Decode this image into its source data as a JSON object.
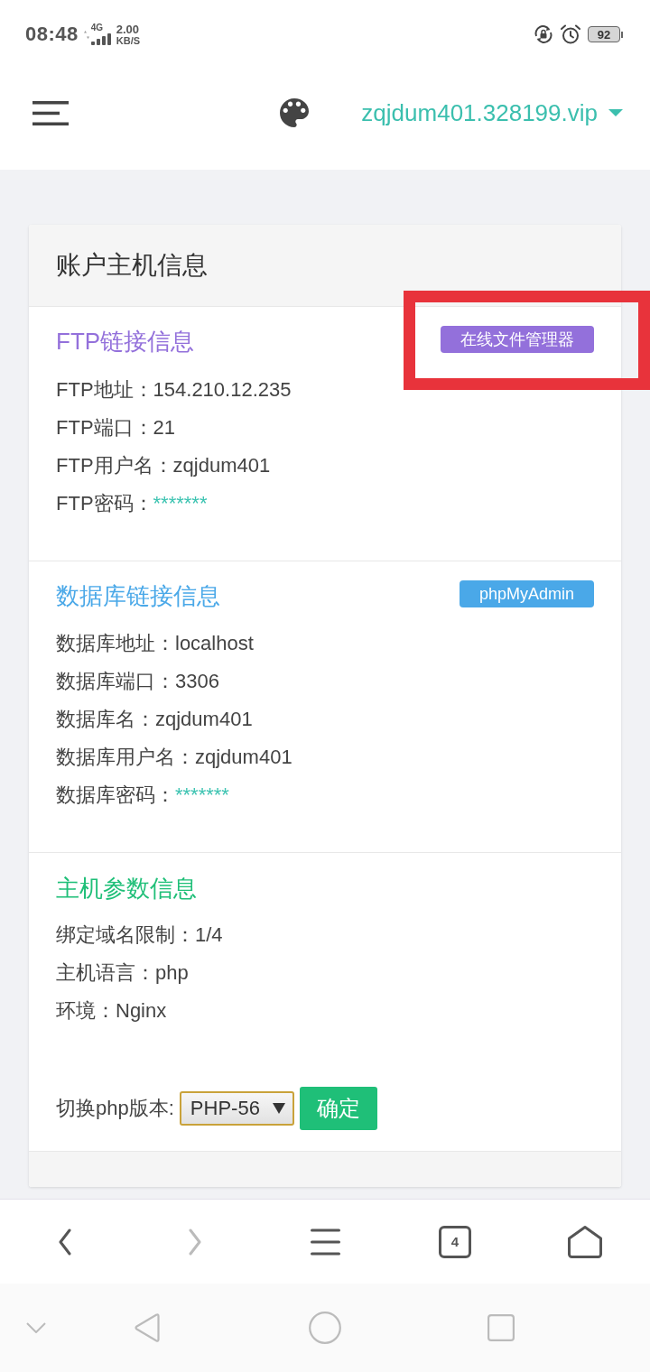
{
  "status_bar": {
    "time": "08:48",
    "network": "4G",
    "speed_value": "2.00",
    "speed_unit": "KB/S",
    "battery": "92"
  },
  "header": {
    "account": "zqjdum401.328199.vip"
  },
  "card": {
    "title": "账户主机信息",
    "sections": [
      {
        "title": "FTP链接信息",
        "color": "#9370db",
        "action": "在线文件管理器",
        "rows": [
          {
            "kind": "plain",
            "label": "FTP地址：",
            "value": "154.210.12.235"
          },
          {
            "kind": "plain",
            "label": "FTP端口：",
            "value": "21"
          },
          {
            "kind": "plain",
            "label": "FTP用户名：",
            "value": "zqjdum401"
          },
          {
            "kind": "secret",
            "label": "FTP密码：",
            "value": "*******"
          }
        ]
      },
      {
        "title": "数据库链接信息",
        "color": "#4aa8e8",
        "action": "phpMyAdmin",
        "rows": [
          {
            "kind": "plain",
            "label": "数据库地址：",
            "value": "localhost"
          },
          {
            "kind": "plain",
            "label": "数据库端口：",
            "value": "3306"
          },
          {
            "kind": "plain",
            "label": "数据库名：",
            "value": "zqjdum401"
          },
          {
            "kind": "plain",
            "label": "数据库用户名：",
            "value": "zqjdum401"
          },
          {
            "kind": "secret",
            "label": "数据库密码：",
            "value": "*******"
          }
        ]
      },
      {
        "title": "主机参数信息",
        "color": "#1fbf78",
        "rows": [
          {
            "kind": "plain",
            "label": "绑定域名限制：",
            "value": "1/4"
          },
          {
            "kind": "plain",
            "label": "主机语言：",
            "value": "php"
          },
          {
            "kind": "plain",
            "label": "环境：",
            "value": "Nginx"
          }
        ],
        "switcher": {
          "label": "切换php版本:",
          "value": "PHP-56",
          "button": "确定"
        }
      }
    ]
  },
  "browser_bar": {
    "back_disabled": false,
    "forward_disabled": true,
    "tab_count": "4"
  }
}
